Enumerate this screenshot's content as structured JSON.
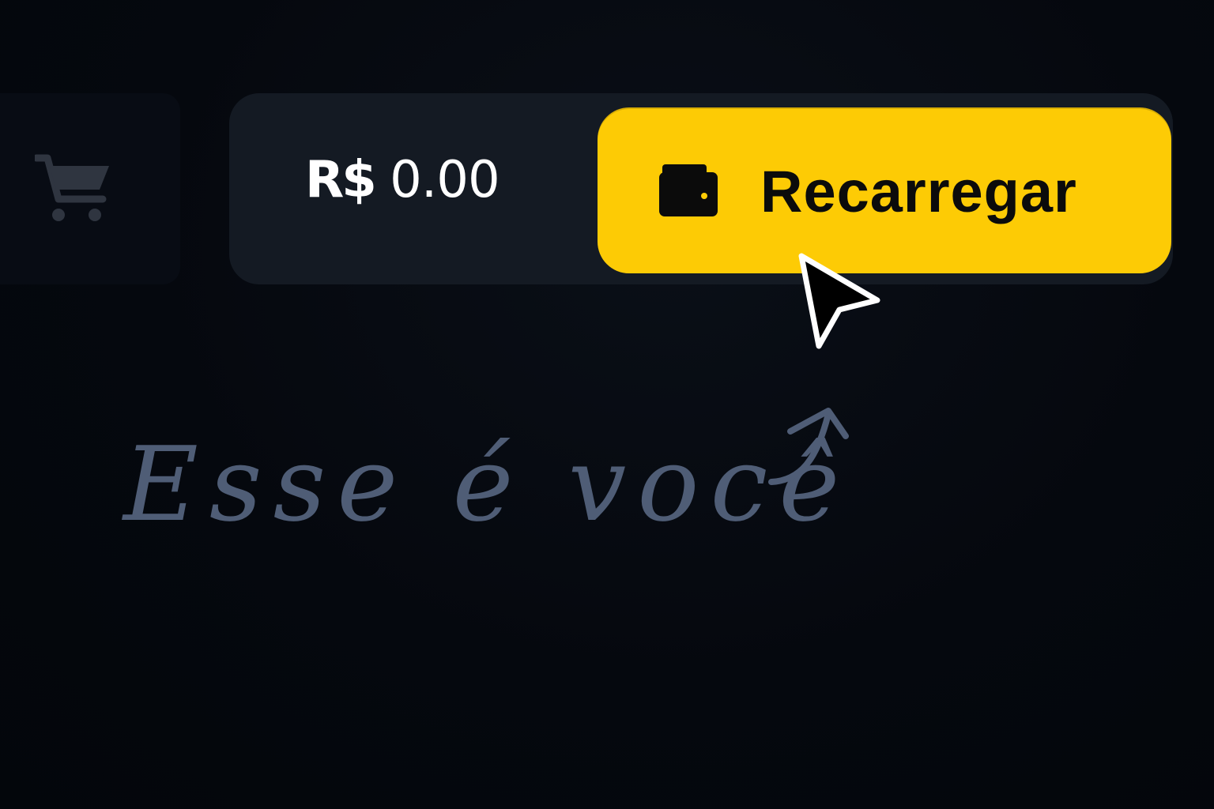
{
  "header": {
    "balance": {
      "currency": "R$",
      "amount": "0.00"
    },
    "recharge_button": {
      "label": "Recarregar",
      "icon": "wallet-icon"
    },
    "cart_icon": "cart-icon"
  },
  "annotation": {
    "text": "Esse é você",
    "arrow_icon": "curved-arrow-icon"
  },
  "colors": {
    "background": "#04070d",
    "wallet_bar": "#141a23",
    "accent_yellow": "#fdcb05",
    "annotation": "#4f5d76",
    "cart_icon": "#2f3540"
  }
}
